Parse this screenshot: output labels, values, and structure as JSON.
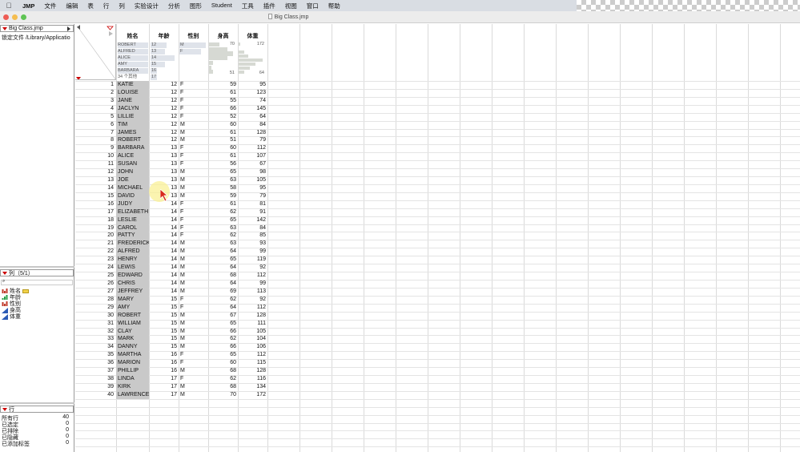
{
  "menubar": {
    "app": "JMP",
    "items": [
      "文件",
      "编辑",
      "表",
      "行",
      "列",
      "实验设计",
      "分析",
      "图形",
      "Student",
      "工具",
      "插件",
      "视图",
      "窗口",
      "帮助"
    ]
  },
  "window": {
    "title": "Big Class.jmp"
  },
  "left_panel": {
    "table_name": "Big Class.jmp",
    "source_label": "锁定文件  /Library/Applicatio",
    "columns_header": "列（5/1）",
    "columns": [
      {
        "name": "姓名",
        "kind": "nominal"
      },
      {
        "name": "年龄",
        "kind": "ordinal"
      },
      {
        "name": "性别",
        "kind": "nominal"
      },
      {
        "name": "身高",
        "kind": "continuous"
      },
      {
        "name": "体重",
        "kind": "continuous"
      }
    ],
    "rows_header": "行",
    "row_stats": [
      {
        "label": "所有行",
        "value": "40"
      },
      {
        "label": "已选定",
        "value": "0"
      },
      {
        "label": "已排除",
        "value": "0"
      },
      {
        "label": "已隐藏",
        "value": "0"
      },
      {
        "label": "已添加标签",
        "value": "0"
      }
    ]
  },
  "table": {
    "headers": [
      "姓名",
      "年龄",
      "性别",
      "身高",
      "体重"
    ],
    "summary": {
      "names": [
        "ROBERT",
        "ALFRED",
        "ALICE",
        "AMY",
        "BARBARA",
        "34 个其他"
      ],
      "age_labels": [
        "12",
        "13",
        "14",
        "15",
        "16",
        "17"
      ],
      "age_fractions": [
        0.2,
        0.175,
        0.3,
        0.175,
        0.075,
        0.075
      ],
      "sex_labels": [
        "M",
        "F"
      ],
      "sex_fractions": [
        0.55,
        0.45
      ],
      "height_max": "70",
      "height_min": "51",
      "weight_max": "172",
      "weight_min": "64"
    },
    "rows": [
      [
        "KATIE",
        "12",
        "F",
        "59",
        "95"
      ],
      [
        "LOUISE",
        "12",
        "F",
        "61",
        "123"
      ],
      [
        "JANE",
        "12",
        "F",
        "55",
        "74"
      ],
      [
        "JACLYN",
        "12",
        "F",
        "66",
        "145"
      ],
      [
        "LILLIE",
        "12",
        "F",
        "52",
        "64"
      ],
      [
        "TIM",
        "12",
        "M",
        "60",
        "84"
      ],
      [
        "JAMES",
        "12",
        "M",
        "61",
        "128"
      ],
      [
        "ROBERT",
        "12",
        "M",
        "51",
        "79"
      ],
      [
        "BARBARA",
        "13",
        "F",
        "60",
        "112"
      ],
      [
        "ALICE",
        "13",
        "F",
        "61",
        "107"
      ],
      [
        "SUSAN",
        "13",
        "F",
        "56",
        "67"
      ],
      [
        "JOHN",
        "13",
        "M",
        "65",
        "98"
      ],
      [
        "JOE",
        "13",
        "M",
        "63",
        "105"
      ],
      [
        "MICHAEL",
        "13",
        "M",
        "58",
        "95"
      ],
      [
        "DAVID",
        "13",
        "M",
        "59",
        "79"
      ],
      [
        "JUDY",
        "14",
        "F",
        "61",
        "81"
      ],
      [
        "ELIZABETH",
        "14",
        "F",
        "62",
        "91"
      ],
      [
        "LESLIE",
        "14",
        "F",
        "65",
        "142"
      ],
      [
        "CAROL",
        "14",
        "F",
        "63",
        "84"
      ],
      [
        "PATTY",
        "14",
        "F",
        "62",
        "85"
      ],
      [
        "FREDERICK",
        "14",
        "M",
        "63",
        "93"
      ],
      [
        "ALFRED",
        "14",
        "M",
        "64",
        "99"
      ],
      [
        "HENRY",
        "14",
        "M",
        "65",
        "119"
      ],
      [
        "LEWIS",
        "14",
        "M",
        "64",
        "92"
      ],
      [
        "EDWARD",
        "14",
        "M",
        "68",
        "112"
      ],
      [
        "CHRIS",
        "14",
        "M",
        "64",
        "99"
      ],
      [
        "JEFFREY",
        "14",
        "M",
        "69",
        "113"
      ],
      [
        "MARY",
        "15",
        "F",
        "62",
        "92"
      ],
      [
        "AMY",
        "15",
        "F",
        "64",
        "112"
      ],
      [
        "ROBERT",
        "15",
        "M",
        "67",
        "128"
      ],
      [
        "WILLIAM",
        "15",
        "M",
        "65",
        "111"
      ],
      [
        "CLAY",
        "15",
        "M",
        "66",
        "105"
      ],
      [
        "MARK",
        "15",
        "M",
        "62",
        "104"
      ],
      [
        "DANNY",
        "15",
        "M",
        "66",
        "106"
      ],
      [
        "MARTHA",
        "16",
        "F",
        "65",
        "112"
      ],
      [
        "MARION",
        "16",
        "F",
        "60",
        "115"
      ],
      [
        "PHILLIP",
        "16",
        "M",
        "68",
        "128"
      ],
      [
        "LINDA",
        "17",
        "F",
        "62",
        "116"
      ],
      [
        "KIRK",
        "17",
        "M",
        "68",
        "134"
      ],
      [
        "LAWRENCE",
        "17",
        "M",
        "70",
        "172"
      ]
    ]
  }
}
